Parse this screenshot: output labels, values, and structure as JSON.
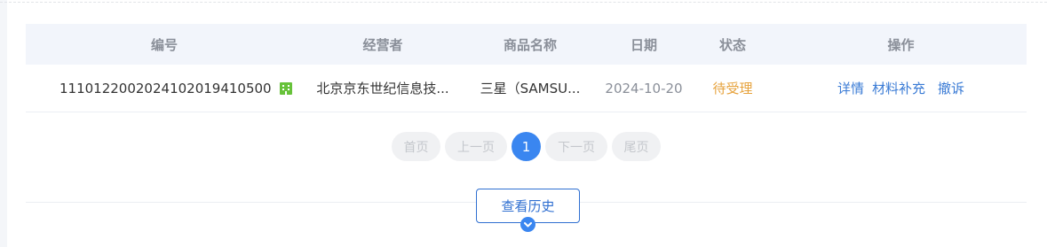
{
  "table": {
    "headers": {
      "id": "编号",
      "operator": "经营者",
      "product": "商品名称",
      "date": "日期",
      "status": "状态",
      "actions": "操作"
    },
    "rows": [
      {
        "id": "111012200202410201941050​0",
        "operator": "北京京东世纪信息技...",
        "product": "三星（SAMSU...",
        "date": "2024-10-20",
        "status": "待受理",
        "actions": {
          "detail": "详情",
          "supplement": "材料补充",
          "withdraw": "撤诉"
        }
      }
    ]
  },
  "pagination": {
    "first": "首页",
    "prev": "上一页",
    "current": "1",
    "next": "下一页",
    "last": "尾页"
  },
  "history_button": "查看历史",
  "colors": {
    "accent": "#3a86f0",
    "link": "#3a7bd5",
    "status_pending": "#e6a23c",
    "building_icon": "#67c23a"
  }
}
